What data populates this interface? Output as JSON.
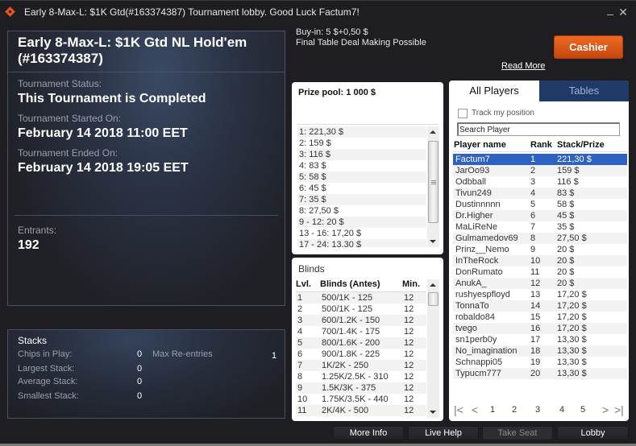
{
  "window": {
    "title": "Early 8-Max-L: $1K Gtd(#163374387) Tournament lobby. Good Luck Factum7!",
    "minimize_label": "_",
    "close_label": "✕"
  },
  "info": {
    "tournament_name": "Early 8-Max-L: $1K Gtd NL Hold'em (#163374387)",
    "status_label": "Tournament Status:",
    "status_value": "This Tournament is Completed",
    "started_label": "Tournament Started On:",
    "started_value": "February 14 2018  11:00 EET",
    "ended_label": "Tournament Ended On:",
    "ended_value": "February 14 2018  19:05 EET",
    "entrants_label": "Entrants:",
    "entrants_value": "192"
  },
  "stacks": {
    "title": "Stacks",
    "rows": [
      {
        "label": "Chips in Play:",
        "value": "0"
      },
      {
        "label": "Largest Stack:",
        "value": "0"
      },
      {
        "label": "Average Stack:",
        "value": "0"
      },
      {
        "label": "Smallest Stack:",
        "value": "0"
      }
    ],
    "max_reentries_label": "Max Re-entries",
    "max_reentries_value": "1"
  },
  "header": {
    "buyin": "Buy-in: 5 $+0,50 $",
    "deal": "Final Table Deal Making Possible",
    "cashier_label": "Cashier",
    "read_more_label": "Read More",
    "accent_color": "#e05a18"
  },
  "prize": {
    "title": "Prize pool: 1 000 $",
    "items": [
      "1: 221,30 $",
      "2: 159 $",
      "3: 116 $",
      "4: 83 $",
      "5: 58 $",
      "6: 45 $",
      "7: 35 $",
      "8: 27,50 $",
      "9 - 12: 20 $",
      "13 - 16: 17,20 $",
      "17 - 24: 13,30 $"
    ]
  },
  "blinds": {
    "title": "Blinds",
    "headers": {
      "level": "Lvl.",
      "blinds": "Blinds (Antes)",
      "minutes": "Min."
    },
    "rows": [
      {
        "level": "1",
        "blinds": "500/1K - 125",
        "minutes": "12"
      },
      {
        "level": "2",
        "blinds": "500/1K - 125",
        "minutes": "12"
      },
      {
        "level": "3",
        "blinds": "600/1.2K - 150",
        "minutes": "12"
      },
      {
        "level": "4",
        "blinds": "700/1.4K - 175",
        "minutes": "12"
      },
      {
        "level": "5",
        "blinds": "800/1.6K - 200",
        "minutes": "12"
      },
      {
        "level": "6",
        "blinds": "900/1.8K - 225",
        "minutes": "12"
      },
      {
        "level": "7",
        "blinds": "1K/2K - 250",
        "minutes": "12"
      },
      {
        "level": "8",
        "blinds": "1.25K/2.5K - 310",
        "minutes": "12"
      },
      {
        "level": "9",
        "blinds": "1.5K/3K - 375",
        "minutes": "12"
      },
      {
        "level": "10",
        "blinds": "1.75K/3.5K - 440",
        "minutes": "12"
      },
      {
        "level": "11",
        "blinds": "2K/4K - 500",
        "minutes": "12"
      }
    ]
  },
  "players": {
    "tabs": [
      {
        "label": "All Players",
        "active": true
      },
      {
        "label": "Tables",
        "active": false
      }
    ],
    "track_label": "Track my position",
    "track_checked": false,
    "search_value": "Search Player",
    "headers": {
      "name": "Player name",
      "rank": "Rank",
      "prize": "Stack/Prize"
    },
    "rows": [
      {
        "name": "Factum7",
        "rank": "1",
        "prize": "221,30 $",
        "selected": true
      },
      {
        "name": "JarOo93",
        "rank": "2",
        "prize": "159 $"
      },
      {
        "name": "Odbball",
        "rank": "3",
        "prize": "116 $"
      },
      {
        "name": "Tivun249",
        "rank": "4",
        "prize": "83 $"
      },
      {
        "name": "Dustinnnnn",
        "rank": "5",
        "prize": "58 $"
      },
      {
        "name": "Dr.Higher",
        "rank": "6",
        "prize": "45 $"
      },
      {
        "name": "MaLiReNe",
        "rank": "7",
        "prize": "35 $"
      },
      {
        "name": "Gulmamedov69",
        "rank": "8",
        "prize": "27,50 $"
      },
      {
        "name": "Prinz__Nemo",
        "rank": "9",
        "prize": "20 $"
      },
      {
        "name": "InTheRock",
        "rank": "10",
        "prize": "20 $"
      },
      {
        "name": "DonRumato",
        "rank": "11",
        "prize": "20 $"
      },
      {
        "name": "AnukA_",
        "rank": "12",
        "prize": "20 $"
      },
      {
        "name": "rushyespfloyd",
        "rank": "13",
        "prize": "17,20 $"
      },
      {
        "name": "TonnaTo",
        "rank": "14",
        "prize": "17,20 $"
      },
      {
        "name": "robaldo84",
        "rank": "15",
        "prize": "17,20 $"
      },
      {
        "name": "tvego",
        "rank": "16",
        "prize": "17,20 $"
      },
      {
        "name": "sn1perb0y",
        "rank": "17",
        "prize": "13,30 $"
      },
      {
        "name": "No_imagination",
        "rank": "18",
        "prize": "13,30 $"
      },
      {
        "name": "Schnappi05",
        "rank": "19",
        "prize": "13,30 $"
      },
      {
        "name": "Typucm777",
        "rank": "20",
        "prize": "13,30 $"
      }
    ],
    "pager": {
      "first": "|<",
      "prev": "<",
      "pages": [
        "1",
        "2",
        "3",
        "4",
        "5"
      ],
      "current_page": "1",
      "next": ">",
      "last": ">|"
    },
    "selected_color": "#2d62c3",
    "tab_active_bg": "#ffffff",
    "tab_inactive_bg": "#1f3a66"
  },
  "bottom": {
    "more_info": "More Info",
    "live_help": "Live Help",
    "take_seat": "Take Seat",
    "lobby": "Lobby"
  }
}
